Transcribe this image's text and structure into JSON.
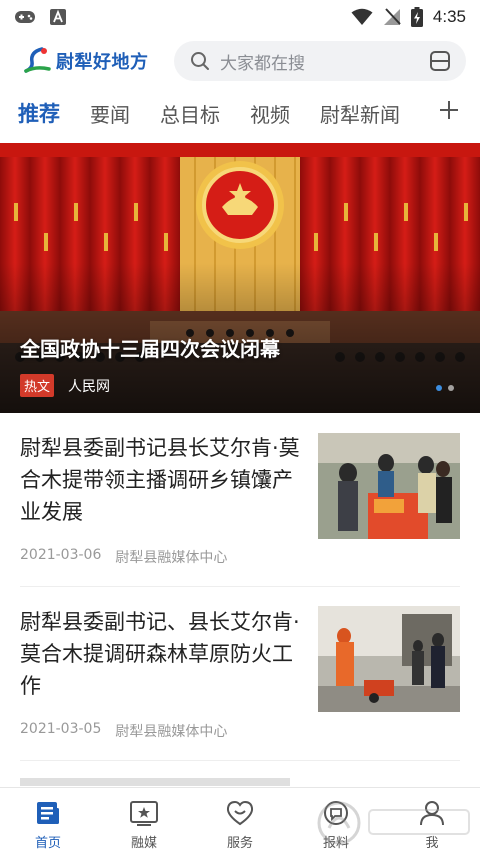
{
  "status_bar": {
    "time": "4:35"
  },
  "header": {
    "logo_text": "尉犁好地方",
    "search_placeholder": "大家都在搜"
  },
  "tabs": [
    {
      "label": "推荐",
      "active": true
    },
    {
      "label": "要闻",
      "active": false
    },
    {
      "label": "总目标",
      "active": false
    },
    {
      "label": "视频",
      "active": false
    },
    {
      "label": "尉犁新闻",
      "active": false
    }
  ],
  "banner": {
    "title": "全国政协十三届四次会议闭幕",
    "tag": "热文",
    "source": "人民网"
  },
  "news": [
    {
      "title": "尉犁县委副书记县长艾尔肯·莫合木提带领主播调研乡镇馕产业发展",
      "date": "2021-03-06",
      "source": "尉犁县融媒体中心"
    },
    {
      "title": "尉犁县委副书记、县长艾尔肯·莫合木提调研森林草原防火工作",
      "date": "2021-03-05",
      "source": "尉犁县融媒体中心"
    }
  ],
  "bottom_nav": [
    {
      "label": "首页",
      "icon": "home-icon",
      "active": true
    },
    {
      "label": "融媒",
      "icon": "media-icon",
      "active": false
    },
    {
      "label": "服务",
      "icon": "service-heart-icon",
      "active": false
    },
    {
      "label": "报料",
      "icon": "report-icon",
      "active": false
    },
    {
      "label": "我",
      "icon": "user-icon",
      "active": false
    }
  ],
  "colors": {
    "accent": "#1f5fb8",
    "hot_tag": "#d23a2a",
    "banner_red": "#b5120f"
  }
}
